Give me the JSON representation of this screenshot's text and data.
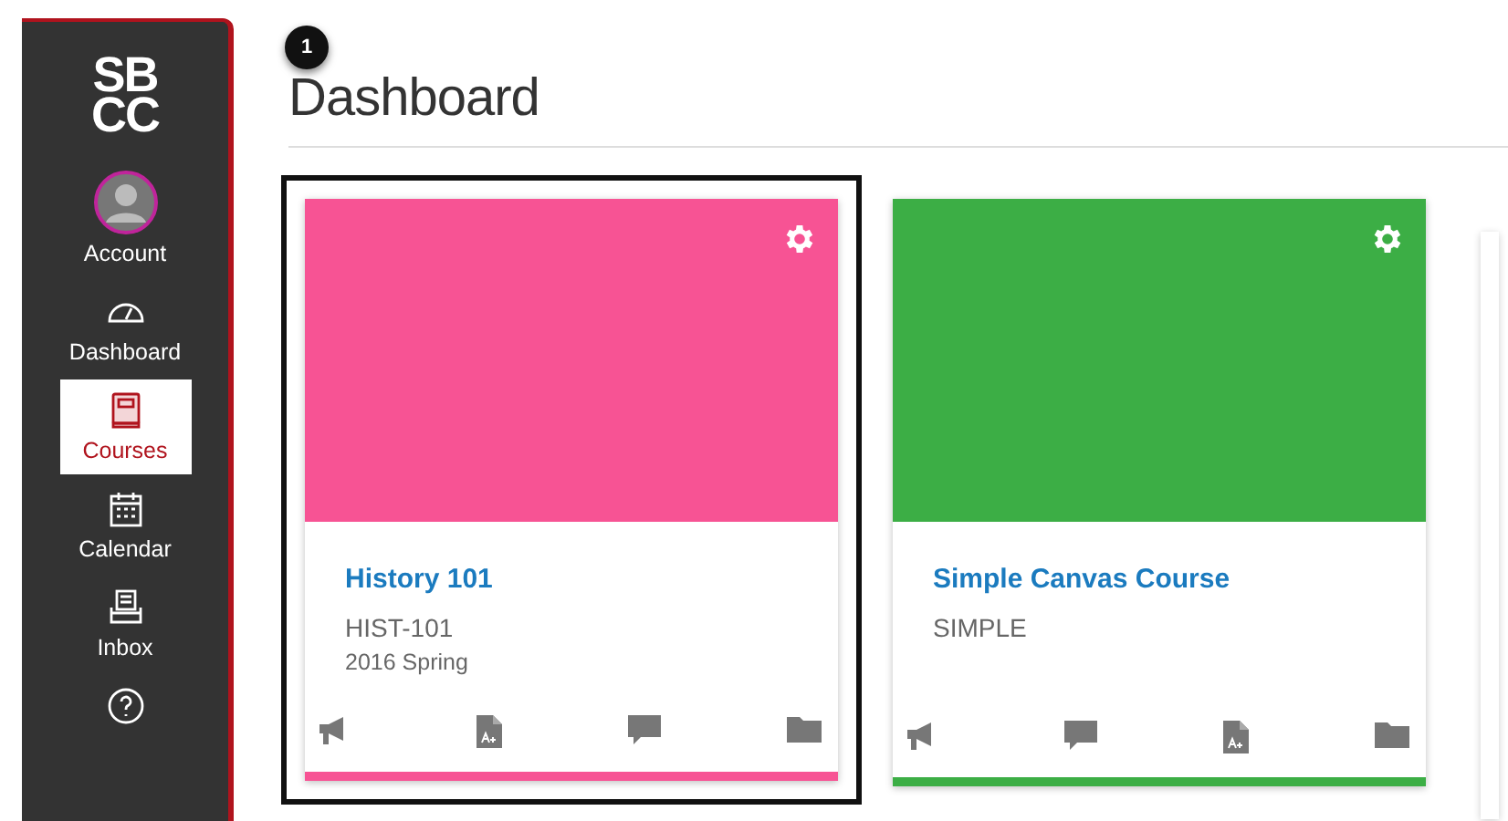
{
  "sidebar": {
    "logo": [
      "SB",
      "CC"
    ],
    "items": [
      {
        "kind": "account",
        "label": "Account",
        "selected": false
      },
      {
        "kind": "dashboard",
        "label": "Dashboard",
        "selected": false
      },
      {
        "kind": "courses",
        "label": "Courses",
        "selected": true
      },
      {
        "kind": "calendar",
        "label": "Calendar",
        "selected": false
      },
      {
        "kind": "inbox",
        "label": "Inbox",
        "selected": false
      },
      {
        "kind": "help",
        "selected": false
      }
    ]
  },
  "step_badge": "1",
  "page_title": "Dashboard",
  "cards": [
    {
      "title": "History 101",
      "code": "HIST-101",
      "term": "2016 Spring",
      "color": "#f75394",
      "selected": true,
      "actions": [
        {
          "kind": "announcement"
        },
        {
          "kind": "assignment"
        },
        {
          "kind": "discussion"
        },
        {
          "kind": "files"
        }
      ]
    },
    {
      "title": "Simple Canvas Course",
      "code": "SIMPLE",
      "color": "#3cae45",
      "selected": false,
      "actions": [
        {
          "kind": "announcement"
        },
        {
          "kind": "discussion"
        },
        {
          "kind": "assignment"
        },
        {
          "kind": "files"
        }
      ]
    }
  ]
}
